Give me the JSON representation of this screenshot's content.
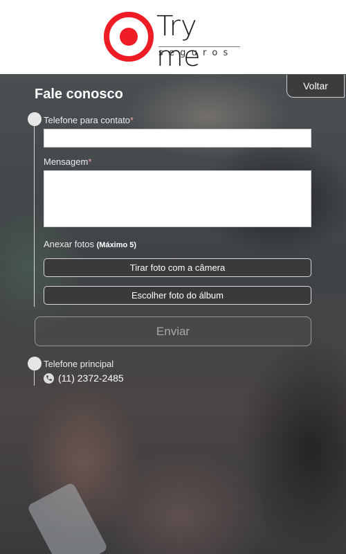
{
  "brand": {
    "name": "Try me",
    "tagline": "seguros",
    "accent_color": "#ee1c25"
  },
  "header": {
    "back_label": "Voltar"
  },
  "contact_form": {
    "title": "Fale conosco",
    "phone_label": "Telefone para contato",
    "phone_required_mark": "*",
    "phone_value": "",
    "message_label": "Mensagem",
    "message_required_mark": "*",
    "message_value": "",
    "attach_label": "Anexar fotos",
    "attach_note": "(Máximo 5)",
    "camera_button": "Tirar foto com a câmera",
    "album_button": "Escolher foto do álbum",
    "send_button": "Enviar"
  },
  "main_phone": {
    "label": "Telefone principal",
    "number": "(11) 2372-2485",
    "icon": "phone-icon"
  }
}
